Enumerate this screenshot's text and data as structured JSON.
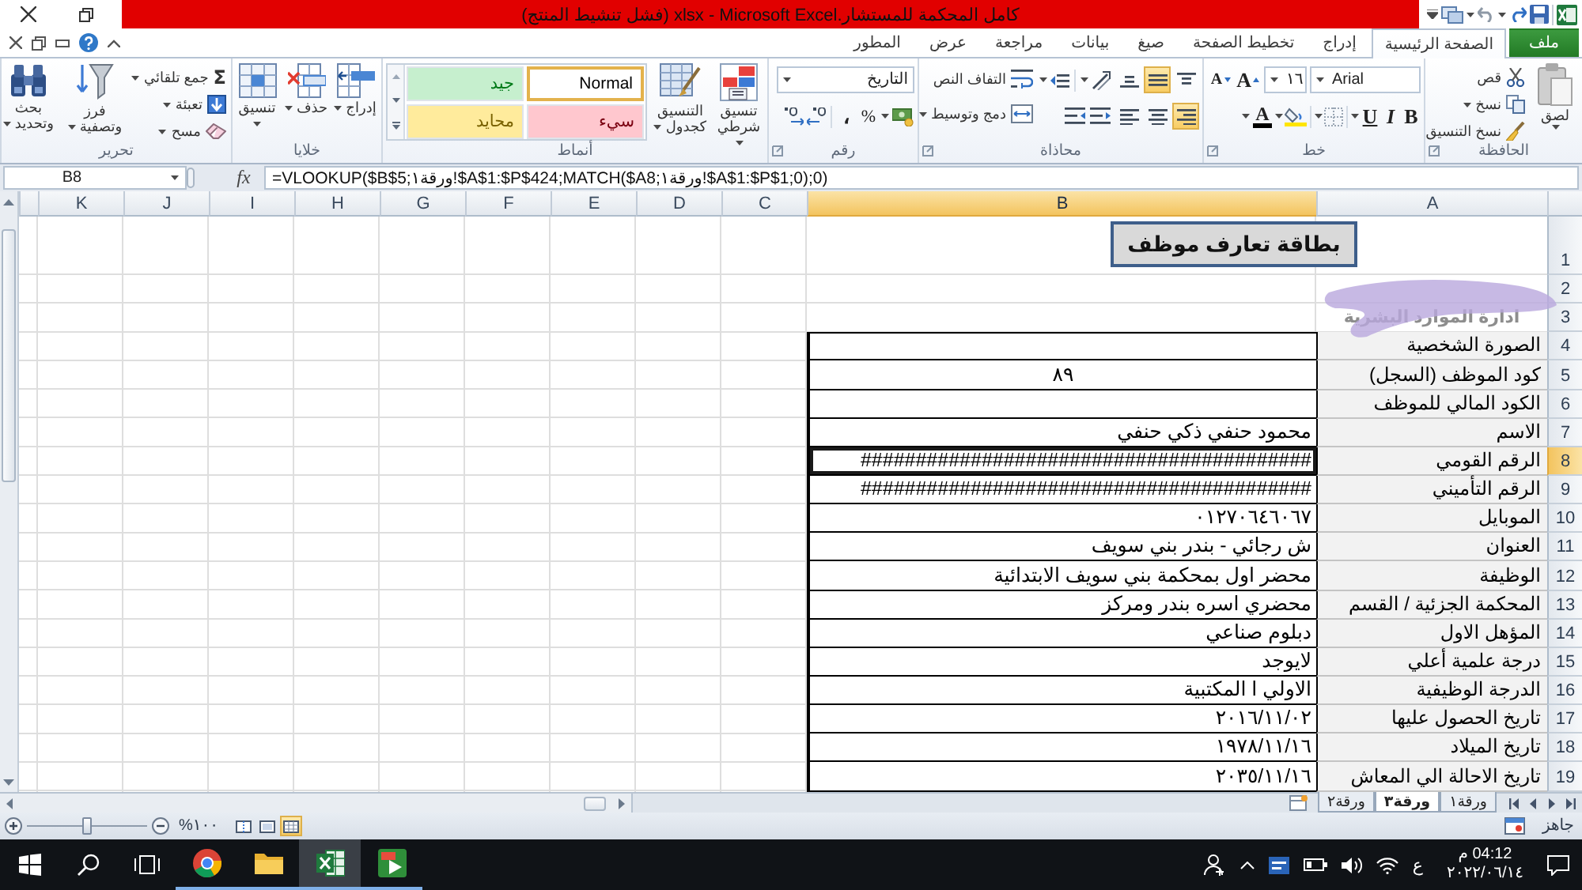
{
  "title_bar": {
    "title": "كامل المحكمة للمستشار.xlsx - Microsoft Excel (فشل تنشيط المنتج)"
  },
  "ribbon_tabs": [
    {
      "label": "ملف",
      "kind": "file",
      "selected": false
    },
    {
      "label": "الصفحة الرئيسية",
      "kind": "tab",
      "selected": true
    },
    {
      "label": "إدراج",
      "kind": "tab",
      "selected": false
    },
    {
      "label": "تخطيط الصفحة",
      "kind": "tab",
      "selected": false
    },
    {
      "label": "صيغ",
      "kind": "tab",
      "selected": false
    },
    {
      "label": "بيانات",
      "kind": "tab",
      "selected": false
    },
    {
      "label": "مراجعة",
      "kind": "tab",
      "selected": false
    },
    {
      "label": "عرض",
      "kind": "tab",
      "selected": false
    },
    {
      "label": "المطور",
      "kind": "tab",
      "selected": false
    }
  ],
  "ribbon_groups": [
    {
      "kind": "clipboard",
      "label": "الحافظة",
      "paste": "لصق",
      "cut": "قص",
      "copy": "نسخ",
      "format_painter": "نسخ التنسيق"
    },
    {
      "kind": "font",
      "label": "خط",
      "font_name": "Arial",
      "font_size": "١٦",
      "grow": "A",
      "shrink": "A",
      "bold": "B",
      "italic": "I",
      "underline": "U",
      "font_color": "A"
    },
    {
      "kind": "alignment",
      "label": "محاذاة",
      "wrap_text": "التفاف النص",
      "merge_center": "دمج وتوسيط",
      "vertical_buttons": [
        {
          "kind": "top",
          "selected": false
        },
        {
          "kind": "middle",
          "selected": true
        },
        {
          "kind": "bottom",
          "selected": false
        }
      ],
      "horizontal_buttons": [
        {
          "kind": "right",
          "selected": true
        },
        {
          "kind": "center",
          "selected": false
        },
        {
          "kind": "left",
          "selected": false
        }
      ]
    },
    {
      "kind": "number",
      "label": "رقم",
      "format": "التاريخ",
      "percent": "%",
      "comma": "،"
    },
    {
      "kind": "styles",
      "label": "أنماط",
      "conditional": "تنسيق شرطي",
      "as_table": "التنسيق كجدول",
      "cell_styles": [
        {
          "label": "Normal",
          "color": "#ffffff",
          "selected": true
        },
        {
          "label": "جيد",
          "color": "#c6efce",
          "selected": false
        },
        {
          "label": "سيء",
          "color": "#ffc7ce",
          "selected": false
        },
        {
          "label": "محايد",
          "color": "#ffeb9c",
          "selected": false
        }
      ]
    },
    {
      "kind": "cells",
      "label": "خلايا",
      "insert": "إدراج",
      "delete": "حذف",
      "format": "تنسيق"
    },
    {
      "kind": "editing",
      "label": "تحرير",
      "autosum_symbol": "Σ",
      "autosum": "جمع تلقائي",
      "fill": "تعبئة",
      "clear": "مسح",
      "sort_filter": "فرز وتصفية",
      "find_select": "بحث وتحديد"
    }
  ],
  "formula_bar": {
    "name_box": "B8",
    "fx": "fx",
    "formula": "=VLOOKUP($B$5;ورقة١!$A$1:$P$424;MATCH($A8;ورقة١!$A$1:$P$1;0);0)"
  },
  "sheet": {
    "title_box": "بطاقة تعارف موظف",
    "columns": [
      {
        "label": "A",
        "selected": false
      },
      {
        "label": "B",
        "selected": true
      },
      {
        "label": "C",
        "selected": false
      },
      {
        "label": "D",
        "selected": false
      },
      {
        "label": "E",
        "selected": false
      },
      {
        "label": "F",
        "selected": false
      },
      {
        "label": "G",
        "selected": false
      },
      {
        "label": "H",
        "selected": false
      },
      {
        "label": "I",
        "selected": false
      },
      {
        "label": "J",
        "selected": false
      },
      {
        "label": "K",
        "selected": false
      }
    ],
    "rows": [
      {
        "number": "1",
        "kind": "blank",
        "selected": false
      },
      {
        "number": "2",
        "kind": "blank",
        "selected": false
      },
      {
        "number": "3",
        "kind": "heading",
        "label": "ادارة الموارد البشرية",
        "selected": false
      },
      {
        "number": "4",
        "kind": "field",
        "label": "الصورة الشخصية",
        "selected": false
      },
      {
        "number": "5",
        "kind": "field",
        "label": "كود الموظف (السجل)",
        "value": "٨٩",
        "value_centered": true,
        "selected": false
      },
      {
        "number": "6",
        "kind": "field",
        "label": "الكود المالي للموظف",
        "selected": false
      },
      {
        "number": "7",
        "kind": "field",
        "label": "الاسم",
        "value": "محمود حنفي ذكي حنفي",
        "value_centered": false,
        "selected": false
      },
      {
        "number": "8",
        "kind": "field",
        "label": "الرقم القومي",
        "value": "#########################################",
        "value_centered": false,
        "selected": true
      },
      {
        "number": "9",
        "kind": "field",
        "label": "الرقم التأميني",
        "value": "#########################################",
        "value_centered": false,
        "selected": false
      },
      {
        "number": "10",
        "kind": "field",
        "label": "الموبايل",
        "value": "٠١٢٧٠٦٤٦٠٦٧",
        "value_centered": false,
        "selected": false
      },
      {
        "number": "11",
        "kind": "field",
        "label": "العنوان",
        "value": "ش رجائي - بندر بني سويف",
        "value_centered": false,
        "selected": false
      },
      {
        "number": "12",
        "kind": "field",
        "label": "الوظيفة",
        "value": "محضر اول بمحكمة بني سويف الابتدائية",
        "value_centered": false,
        "selected": false
      },
      {
        "number": "13",
        "kind": "field",
        "label": "المحكمة الجزئية / القسم",
        "value": "محضري اسره بندر ومركز",
        "value_centered": false,
        "selected": false
      },
      {
        "number": "14",
        "kind": "field",
        "label": "المؤهل الاول",
        "value": "دبلوم صناعي",
        "value_centered": false,
        "selected": false
      },
      {
        "number": "15",
        "kind": "field",
        "label": "درجة علمية أعلي",
        "value": "لايوجد",
        "value_centered": false,
        "selected": false
      },
      {
        "number": "16",
        "kind": "field",
        "label": "الدرجة الوظيفية",
        "value": "الاولي ا المكتبية",
        "value_centered": false,
        "selected": false
      },
      {
        "number": "17",
        "kind": "field",
        "label": "تاريخ الحصول عليها",
        "value": "٢٠١٦/١١/٠٢",
        "value_centered": false,
        "selected": false
      },
      {
        "number": "18",
        "kind": "field",
        "label": "تاريخ الميلاد",
        "value": "١٩٧٨/١١/١٦",
        "value_centered": false,
        "selected": false
      },
      {
        "number": "19",
        "kind": "field",
        "label": "تاريخ الاحالة الي المعاش",
        "value": "٢٠٣٥/١١/١٦",
        "value_centered": false,
        "selected": false
      }
    ]
  },
  "sheet_tabs": [
    {
      "label": "ورقة١",
      "selected": false
    },
    {
      "label": "ورقة٣",
      "selected": true
    },
    {
      "label": "ورقة٢",
      "selected": false
    }
  ],
  "status_bar": {
    "status": "جاهز",
    "zoom": "%١٠٠",
    "zoom_slider": {
      "level": 0.5
    },
    "views": [
      {
        "selected": true
      },
      {
        "selected": false
      },
      {
        "selected": false
      }
    ]
  },
  "taskbar": {
    "apps": [
      {
        "kind": "browser",
        "running": true,
        "selected": false
      },
      {
        "kind": "folder",
        "running": true,
        "selected": false
      },
      {
        "kind": "spreadsheet",
        "running": true,
        "selected": true
      },
      {
        "kind": "video",
        "running": true,
        "selected": false
      }
    ],
    "language": "ع",
    "time": "04:12 م",
    "date": "٢٠٢٢/٠٦/١٤"
  }
}
